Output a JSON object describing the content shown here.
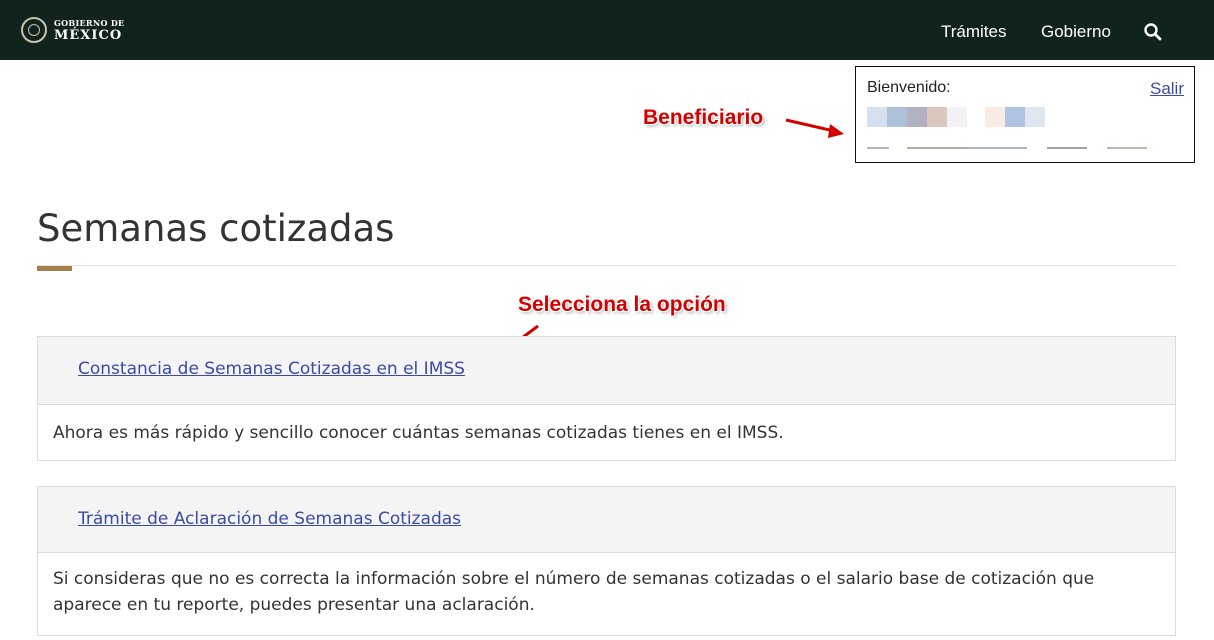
{
  "header": {
    "logo_small": "GOBIERNO DE",
    "logo_big": "MÉXICO",
    "nav": [
      {
        "label": "Trámites"
      },
      {
        "label": "Gobierno"
      }
    ],
    "search_icon": "search-icon",
    "background_color": "#10241c"
  },
  "welcome": {
    "label": "Bienvenido:",
    "logout": "Salir"
  },
  "annotations": {
    "beneficiary": "Beneficiario",
    "select_option": "Selecciona la opción",
    "color": "#d40000"
  },
  "main": {
    "title": "Semanas cotizadas",
    "accent_color": "#a57f4e",
    "cards": [
      {
        "link": "Constancia de Semanas Cotizadas en el IMSS",
        "description": "Ahora es más rápido y sencillo conocer cuántas semanas cotizadas tienes en el IMSS."
      },
      {
        "link": "Trámite de Aclaración de Semanas Cotizadas",
        "description": "Si consideras que no es correcta la información sobre el número de semanas cotizadas o el salario base de cotización que aparece en tu reporte, puedes presentar una aclaración."
      }
    ],
    "link_color": "#3a4ba6"
  }
}
